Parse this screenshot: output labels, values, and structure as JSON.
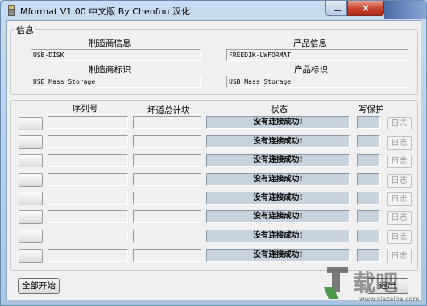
{
  "window": {
    "title": "Mformat V1.00 中文版 By Chenfnu 汉化",
    "close_label": "×"
  },
  "info": {
    "group_title": "信息",
    "manufacturer_info_label": "制造商信息",
    "manufacturer_info_value": "USB-DISK",
    "product_info_label": "产品信息",
    "product_info_value": "FREEDIK-LWFORMAT",
    "manufacturer_id_label": "制造商标识",
    "manufacturer_id_value": "USB Mass Storage",
    "product_id_label": "产品标识",
    "product_id_value": "USB Mass Storage"
  },
  "devices": {
    "headers": {
      "serial": "序列号",
      "bad_block": "坏道总计块",
      "status": "状态",
      "write_protect": "写保护"
    },
    "rows": [
      {
        "status": "没有连接成功!",
        "log": "日志"
      },
      {
        "status": "没有连接成功!",
        "log": "日志"
      },
      {
        "status": "没有连接成功!",
        "log": "日志"
      },
      {
        "status": "没有连接成功!",
        "log": "日志"
      },
      {
        "status": "没有连接成功!",
        "log": "日志"
      },
      {
        "status": "没有连接成功!",
        "log": "日志"
      },
      {
        "status": "没有连接成功!",
        "log": "日志"
      },
      {
        "status": "没有连接成功!",
        "log": "日志"
      }
    ]
  },
  "footer": {
    "start_all_label": "全部开始",
    "exit_label": "退出"
  },
  "watermark": {
    "site": "www.xiazaiba.com"
  }
}
